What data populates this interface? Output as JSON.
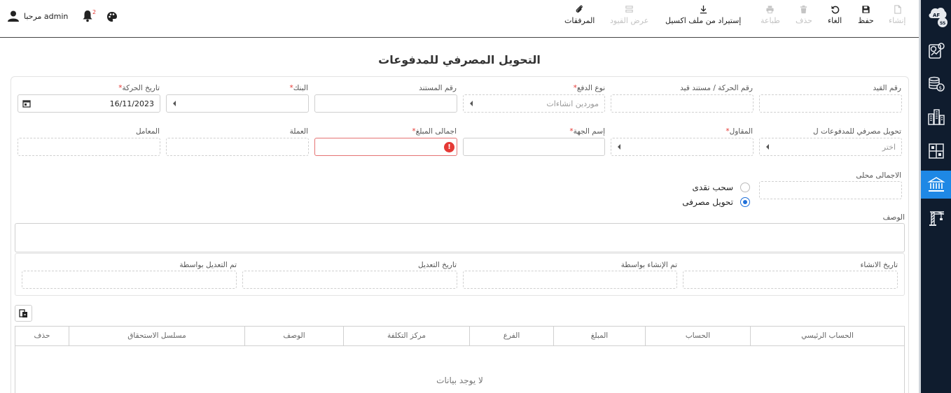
{
  "toolbar": {
    "create": "إنشاء",
    "save": "حفظ",
    "cancel": "الغاء",
    "delete": "حذف",
    "print": "طباعة",
    "import_excel": "إستيراد من ملف اكسيل",
    "show_entries": "عرض القيود",
    "attachments": "المرفقات"
  },
  "user": {
    "greeting": "مرحبا admin",
    "notifications_count": "2"
  },
  "page": {
    "title": "التحويل المصرفي للمدفوعات"
  },
  "form": {
    "entry_no": {
      "label": "رقم القيد",
      "value": ""
    },
    "movement_no": {
      "label": "رقم الحركة / مستند قيد",
      "value": ""
    },
    "payment_type": {
      "label": "نوع الدفع",
      "value": "موردين انشاءات"
    },
    "doc_no": {
      "label": "رقم المستند",
      "value": ""
    },
    "bank": {
      "label": "البنك",
      "value": ""
    },
    "movement_date": {
      "label": "تاريخ الحركة",
      "value": "16/11/2023"
    },
    "transfer_for": {
      "label": "تحويل مصرفي للمدفوعات ل",
      "placeholder": "اختر"
    },
    "contractor": {
      "label": "المقاول",
      "value": ""
    },
    "party_name": {
      "label": "إسم الجهة",
      "value": ""
    },
    "total_amount": {
      "label": "اجمالى المبلغ",
      "value": ""
    },
    "currency": {
      "label": "العملة",
      "value": ""
    },
    "rate": {
      "label": "المعامل",
      "value": ""
    },
    "local_total": {
      "label": "الاجمالى محلى",
      "value": ""
    },
    "method_options": [
      {
        "label": "سحب نقدى",
        "checked": false
      },
      {
        "label": "تحويل مصرفى",
        "checked": true
      }
    ],
    "description": {
      "label": "الوصف",
      "value": ""
    },
    "audit": {
      "created_at": {
        "label": "تاريخ الانشاء",
        "value": ""
      },
      "created_by": {
        "label": "تم الإنشاء بواسطة",
        "value": ""
      },
      "modified_at": {
        "label": "تاريخ التعديل",
        "value": ""
      },
      "modified_by": {
        "label": "تم التعديل بواسطة",
        "value": ""
      }
    }
  },
  "grid": {
    "columns": [
      "الحساب الرئيسي",
      "الحساب",
      "المبلغ",
      "الفرع",
      "مركز التكلفة",
      "الوصف",
      "مسلسل الاستحقاق",
      "حذف"
    ],
    "empty_text": "لا يوجد بيانات"
  },
  "colors": {
    "sidebar_bg": "#0f1c2e",
    "active_item": "#1e88e5",
    "required": "#e53935",
    "radio_checked": "#1e6fd9"
  }
}
